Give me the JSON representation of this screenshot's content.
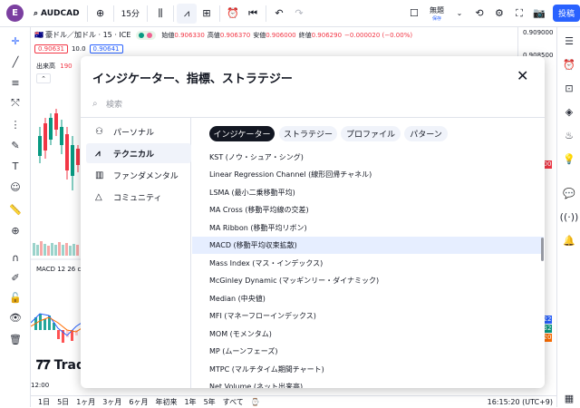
{
  "topbar": {
    "avatar_letter": "E",
    "symbol": "AUDCAD",
    "interval": "15分",
    "layout_name": "無題",
    "layout_status": "保存",
    "publish": "投稿"
  },
  "legend": {
    "title": "豪ドル／加ドル · 15 · ICE",
    "open_label": "始値",
    "open": "0.906330",
    "high_label": "高値",
    "high": "0.906370",
    "low_label": "安値",
    "low": "0.906000",
    "close_label": "終値",
    "close": "0.906290",
    "change": "−0.000020 (−0.00%)",
    "sell_price": "0.90631",
    "spread": "10.0",
    "buy_price": "0.90641",
    "volume_label": "出来高",
    "volume_value": "190",
    "macd_label": "MACD 12 26 cl"
  },
  "price_scale": [
    "0.909000",
    "0.908500"
  ],
  "price_badges": [
    "00",
    "22",
    "32",
    "20"
  ],
  "time_axis": {
    "left_time": "12:00"
  },
  "watermark": "Trad",
  "bottombar": {
    "ranges": [
      "1日",
      "5日",
      "1ヶ月",
      "3ヶ月",
      "6ヶ月",
      "年初来",
      "1年",
      "5年",
      "すべて"
    ],
    "clock": "16:15:20 (UTC+9)"
  },
  "modal": {
    "title": "インジケーター、指標、ストラテジー",
    "search_placeholder": "検索",
    "categories": [
      {
        "label": "パーソナル",
        "icon": "person-icon"
      },
      {
        "label": "テクニカル",
        "icon": "chart-line-icon",
        "active": true
      },
      {
        "label": "ファンダメンタル",
        "icon": "bar-chart-icon"
      },
      {
        "label": "コミュニティ",
        "icon": "community-icon"
      }
    ],
    "tabs": [
      {
        "label": "インジケーター",
        "active": true
      },
      {
        "label": "ストラテジー"
      },
      {
        "label": "プロファイル"
      },
      {
        "label": "パターン"
      }
    ],
    "items": [
      "KST (ノウ・シュア・シング)",
      "Linear Regression Channel (線形回帰チャネル)",
      "LSMA (最小二乗移動平均)",
      "MA Cross (移動平均線の交差)",
      "MA Ribbon (移動平均リボン)",
      "MACD (移動平均収束拡散)",
      "Mass Index (マス・インデックス)",
      "McGinley Dynamic (マッギンリー・ダイナミック)",
      "Median (中央値)",
      "MFI (マネーフローインデックス)",
      "MOM (モメンタム)",
      "MP (ムーンフェーズ)",
      "MTPC (マルチタイム期間チャート)",
      "Net Volume (ネット出来高)"
    ],
    "selected_index": 5
  }
}
